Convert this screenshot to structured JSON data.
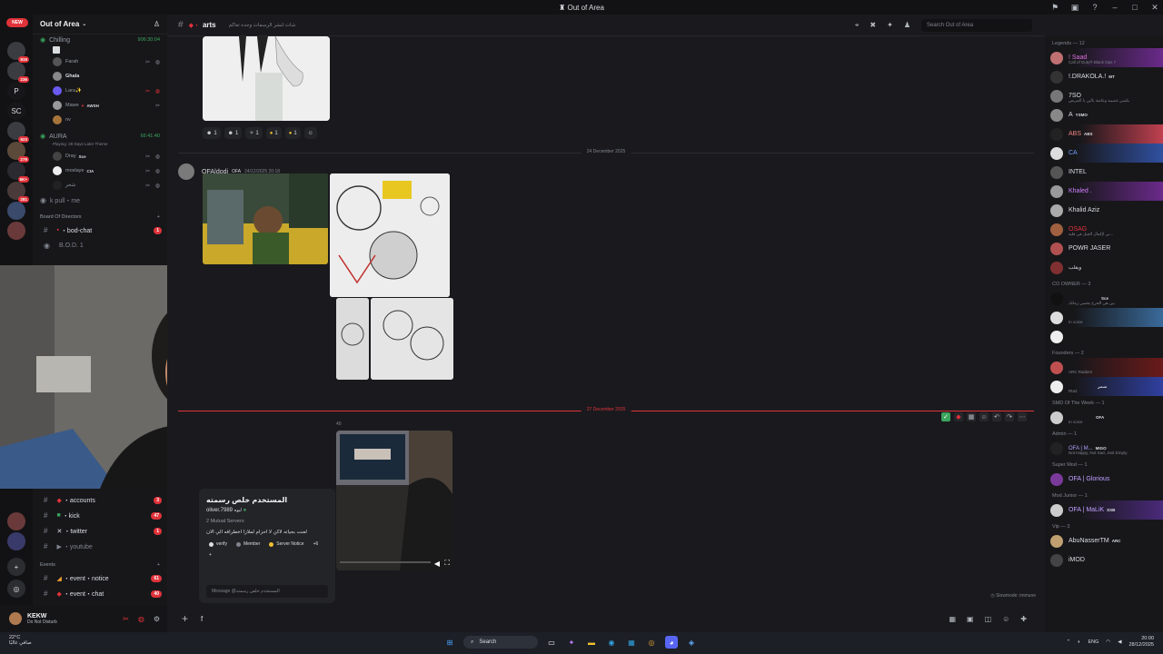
{
  "window": {
    "title": "Out of Area"
  },
  "rail": {
    "new_label": "NEW",
    "servers": [
      {
        "label": "",
        "badge": "819"
      },
      {
        "label": "",
        "badge": "236"
      },
      {
        "label": "P",
        "badge": ""
      },
      {
        "label": "SC",
        "badge": ""
      },
      {
        "label": "",
        "badge": "623"
      },
      {
        "label": "",
        "badge": "279"
      },
      {
        "label": "",
        "badge": "5K+"
      },
      {
        "label": "",
        "badge": "281"
      }
    ]
  },
  "sidebar": {
    "server_name": "Out of Area",
    "voice1": {
      "name": "Chilling",
      "timer": "906:30:04",
      "users": [
        {
          "name": "Farah",
          "tag": ""
        },
        {
          "name": "Ghala",
          "tag": ""
        },
        {
          "name": "Lara✨",
          "tag": ""
        },
        {
          "name": "Mawe",
          "tag": "AWSH"
        },
        {
          "name": "nv",
          "tag": ""
        }
      ]
    },
    "voice2": {
      "name": "AURA",
      "sub": "Playing: 28 Days Later Theme",
      "timer": "66:41:40",
      "users": [
        {
          "name": "Dray",
          "tag": "Sce"
        },
        {
          "name": "moslaye",
          "tag": "CIA"
        },
        {
          "name": "شحر",
          "tag": ""
        }
      ]
    },
    "channels_top": [
      {
        "name": "k pull・me",
        "badge": ""
      }
    ],
    "category": "Board Of Directors",
    "channels_mid": [
      {
        "name": "・bod-chat",
        "badge": "1"
      },
      {
        "name": "B.O.D. 1",
        "badge": ""
      }
    ],
    "channels_bottom": [
      {
        "name": "・accounts",
        "badge": "3"
      },
      {
        "name": "・kick",
        "badge": "47"
      },
      {
        "name": "・twitter",
        "badge": "1"
      },
      {
        "name": "・youtube",
        "badge": ""
      }
    ],
    "events_category": "Events",
    "events": [
      {
        "name": "・event・notice",
        "badge": "61"
      },
      {
        "name": "・event・chat",
        "badge": "40"
      }
    ]
  },
  "userbar": {
    "name": "KEKW",
    "status": "Do Not Disturb"
  },
  "chat": {
    "channel": "arts",
    "topic": "شات لنشر الرسمات وحده تعاكم",
    "search_placeholder": "Search Out of Area",
    "reactions": [
      "1",
      "1",
      "1",
      "1",
      "1"
    ],
    "date1": "24 December 2025",
    "msg1": {
      "author": "OFA|dodi",
      "tag": "OFA",
      "time": "24/12/2025 20:18"
    },
    "date2": "27 December 2025",
    "msg2_time": "40",
    "slowmode": "Slowmode: immune",
    "composer_text": "f"
  },
  "profile": {
    "display_name": "المستخدم خلص رسمته",
    "username": "oliver.7989",
    "username_tag": "لبوه",
    "mutual": "2 Mutual Servers",
    "bio": "لعنت بحياته لاكن لا احزام لملازا اخطرافه الي الان",
    "roles": [
      "verify",
      "Member",
      "Server Notice"
    ],
    "roles_more": "+6",
    "message_placeholder": "Message @المستخدم خلص رسمته"
  },
  "members": {
    "groups": [
      {
        "header": "Legends — 12",
        "items": [
          {
            "name": "! Saad",
            "sub": "Call of Duty® Black Ops 7",
            "banner": true
          },
          {
            "name": "!.DRAKOLA.!",
            "sub": "",
            "tag": "MT",
            "banner": false
          },
          {
            "name": "7SO",
            "sub": "بكيس عصبية وعاشة بالبن يا المريض",
            "banner": false
          },
          {
            "name": "A",
            "sub": "",
            "tag": "YSMO",
            "banner": false
          },
          {
            "name": "ABS",
            "sub": "",
            "tag": "ABS",
            "banner": true
          },
          {
            "name": "CA",
            "sub": "",
            "banner": true
          },
          {
            "name": "INTEL",
            "sub": "",
            "banner": false
          },
          {
            "name": "Khaled .",
            "sub": "",
            "banner": true
          },
          {
            "name": "Khalid Aziz",
            "sub": "",
            "banner": false
          },
          {
            "name": "OSAG",
            "sub": "بي لإكمال الجبل في قلبه...",
            "banner": false
          },
          {
            "name": "POWR JASER",
            "sub": "",
            "banner": false
          },
          {
            "name": "ويقلب",
            "sub": "",
            "banner": false
          }
        ]
      },
      {
        "header": "CO OWNER — 3",
        "items": [
          {
            "name": "",
            "sub": "بين هي الجرخ يخصي زمانك",
            "tag": "Sce",
            "banner": false
          },
          {
            "name": "",
            "sub": "In voice",
            "banner": true
          },
          {
            "name": "",
            "sub": "",
            "banner": false
          }
        ]
      },
      {
        "header": "Founders — 2",
        "items": [
          {
            "name": "",
            "sub": "ARC Raiders",
            "banner": true
          },
          {
            "name": "",
            "sub": "Rta2",
            "tag": "شمر",
            "banner": true
          }
        ]
      },
      {
        "header": "SMD Of The Week — 1",
        "items": [
          {
            "name": "",
            "sub": "In voice",
            "tag": "OFA",
            "banner": false
          }
        ]
      },
      {
        "header": "Admin — 1",
        "items": [
          {
            "name": "OFA | M...",
            "sub": "Not Happy, Not Sad, Just Empty",
            "tag": "MIGO",
            "banner": false
          }
        ]
      },
      {
        "header": "Super Mod — 1",
        "items": [
          {
            "name": "OFA | Glorious",
            "sub": "",
            "banner": false
          }
        ]
      },
      {
        "header": "Mod Junior — 1",
        "items": [
          {
            "name": "OFA | MaLiK",
            "sub": "",
            "tag": "SXB",
            "banner": true
          }
        ]
      },
      {
        "header": "Vip — 3",
        "items": [
          {
            "name": "AbuNasserTM",
            "sub": "",
            "tag": "ARC",
            "banner": false
          },
          {
            "name": "iMOD",
            "sub": "",
            "banner": false
          }
        ]
      }
    ]
  },
  "taskbar": {
    "weather_temp": "22°C",
    "weather_desc": "صافي غالبًا",
    "search": "Search",
    "lang": "ENG",
    "time": "20:00",
    "date": "28/12/2025"
  },
  "colors": {
    "accent": "#5865f2",
    "danger": "#e0323a",
    "online": "#3ba55d"
  }
}
